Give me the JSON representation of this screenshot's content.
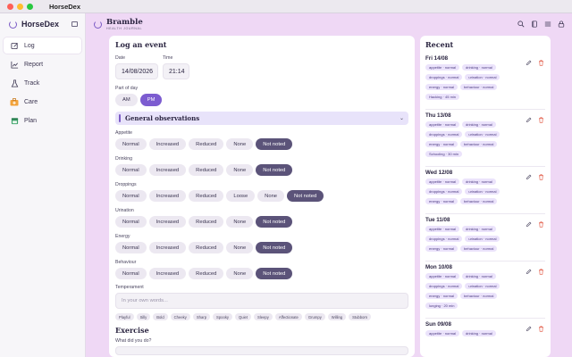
{
  "window": {
    "title": "HorseDex"
  },
  "sidebar": {
    "brand": "HorseDex",
    "items": [
      {
        "label": "Log",
        "icon": "edit-icon",
        "active": true
      },
      {
        "label": "Report",
        "icon": "chart-line-icon",
        "active": false
      },
      {
        "label": "Track",
        "icon": "flask-icon",
        "active": false
      },
      {
        "label": "Care",
        "icon": "first-aid-kit-icon",
        "active": false
      },
      {
        "label": "Plan",
        "icon": "calendar-icon",
        "active": false
      }
    ]
  },
  "header": {
    "title": "Bramble",
    "subtitle": "HEALTH JOURNAL",
    "icons": [
      "search-icon",
      "book-icon",
      "list-icon",
      "lock-icon"
    ]
  },
  "log": {
    "heading": "Log an event",
    "date_label": "Date",
    "date_value": "14/08/2026",
    "time_label": "Time",
    "time_value": "21:14",
    "part_of_day_label": "Part of day",
    "part_of_day_options": [
      "AM",
      "PM"
    ],
    "part_of_day_selected": "PM",
    "general_section": "General observations",
    "observations": [
      {
        "label": "Appetite",
        "options": [
          "Normal",
          "Increased",
          "Reduced",
          "None",
          "Not noted"
        ],
        "selected": "Not noted"
      },
      {
        "label": "Drinking",
        "options": [
          "Normal",
          "Increased",
          "Reduced",
          "None",
          "Not noted"
        ],
        "selected": "Not noted"
      },
      {
        "label": "Droppings",
        "options": [
          "Normal",
          "Increased",
          "Reduced",
          "Loose",
          "None",
          "Not noted"
        ],
        "selected": "Not noted"
      },
      {
        "label": "Urination",
        "options": [
          "Normal",
          "Increased",
          "Reduced",
          "None",
          "Not noted"
        ],
        "selected": "Not noted"
      },
      {
        "label": "Energy",
        "options": [
          "Normal",
          "Increased",
          "Reduced",
          "None",
          "Not noted"
        ],
        "selected": "Not noted"
      },
      {
        "label": "Behaviour",
        "options": [
          "Normal",
          "Increased",
          "Reduced",
          "None",
          "Not noted"
        ],
        "selected": "Not noted"
      }
    ],
    "temperament_label": "Temperament",
    "temperament_placeholder": "In your own words...",
    "temperament_chips": [
      "Playful",
      "Silly",
      "Bold",
      "Cheeky",
      "Sharp",
      "Spooky",
      "Quiet",
      "Sleepy",
      "Affectionate",
      "Grumpy",
      "Willing",
      "Stubborn"
    ],
    "exercise_heading": "Exercise",
    "exercise_question": "What did you do?"
  },
  "recent": {
    "heading": "Recent",
    "entries": [
      {
        "date": "Fri 14/08",
        "tags": [
          "appetite · normal",
          "drinking · normal",
          "droppings · normal",
          "urination · normal",
          "energy · normal",
          "behaviour · normal",
          "Hacking · 45 min"
        ]
      },
      {
        "date": "Thu 13/08",
        "tags": [
          "appetite · normal",
          "drinking · normal",
          "droppings · normal",
          "urination · normal",
          "energy · normal",
          "behaviour · normal",
          "Schooling · 30 min"
        ]
      },
      {
        "date": "Wed 12/08",
        "tags": [
          "appetite · normal",
          "drinking · normal",
          "droppings · normal",
          "urination · normal",
          "energy · normal",
          "behaviour · normal"
        ]
      },
      {
        "date": "Tue 11/08",
        "tags": [
          "appetite · normal",
          "drinking · normal",
          "droppings · normal",
          "urination · normal",
          "energy · normal",
          "behaviour · normal"
        ]
      },
      {
        "date": "Mon 10/08",
        "tags": [
          "appetite · normal",
          "drinking · normal",
          "droppings · normal",
          "urination · normal",
          "energy · normal",
          "behaviour · normal",
          "lunging · 20 min"
        ]
      },
      {
        "date": "Sun 09/08",
        "tags": [
          "appetite · normal",
          "drinking · normal"
        ]
      }
    ]
  },
  "colors": {
    "accent": "#7c5cd0",
    "selected_chip": "#5b5379",
    "background": "#efd8f5",
    "delete": "#e0533f"
  }
}
